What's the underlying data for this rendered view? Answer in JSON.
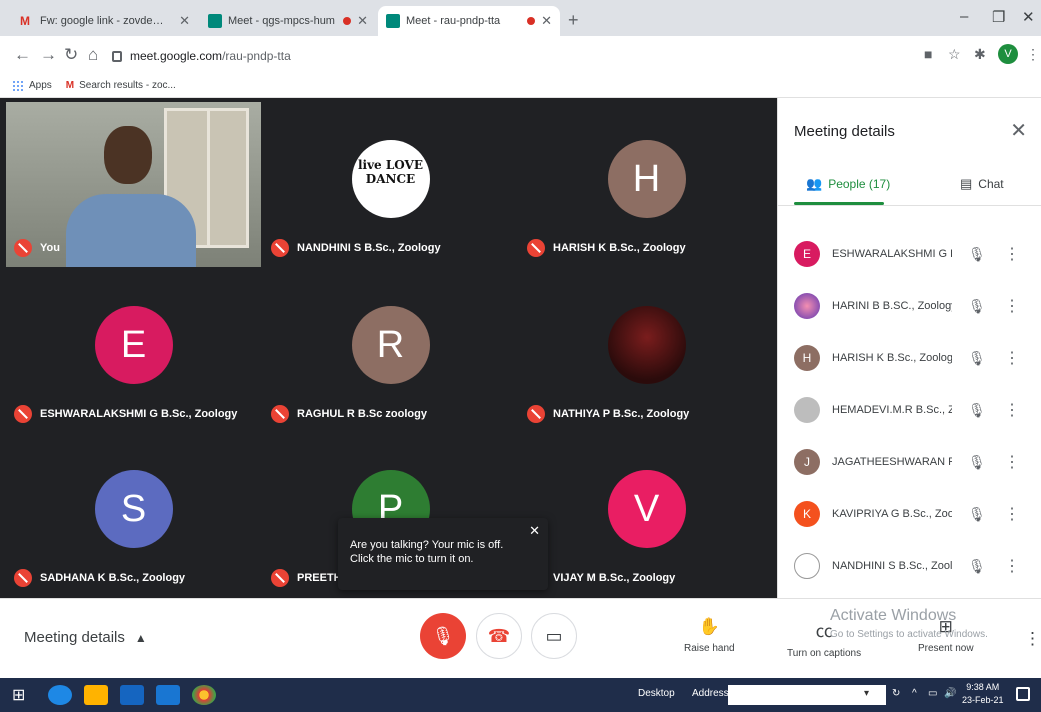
{
  "browser": {
    "tabs": [
      {
        "label": "Fw: google link - zovde@muthayammal",
        "active": false,
        "recording": false
      },
      {
        "label": "Meet - qgs-mpcs-hum",
        "active": false,
        "recording": true
      },
      {
        "label": "Meet - rau-pndp-tta",
        "active": true,
        "recording": true
      }
    ],
    "new_tab": "+",
    "window_controls": [
      "–",
      "❐",
      "✕"
    ],
    "url_host": "meet.google.com",
    "url_path": "/rau-pndp-tta",
    "profile_initial": "V",
    "bookmarks": [
      {
        "label": "Apps"
      },
      {
        "label": "Search results - zoc..."
      }
    ]
  },
  "meet": {
    "tiles": [
      {
        "label": "You",
        "type": "self"
      },
      {
        "label": "NANDHINI S B.Sc., Zoology",
        "type": "dance",
        "avatar_text": "live LOVE DANCE"
      },
      {
        "label": "HARISH K B.Sc., Zoology",
        "type": "letter",
        "letter": "H",
        "color": "#8d6e63"
      },
      {
        "label": "ESHWARALAKSHMI G B.Sc., Zoology",
        "type": "letter",
        "letter": "E",
        "color": "#d81b60"
      },
      {
        "label": "RAGHUL R B.Sc zoology",
        "type": "letter",
        "letter": "R",
        "color": "#8d6e63"
      },
      {
        "label": "NATHIYA P B.Sc., Zoology",
        "type": "dark"
      },
      {
        "label": "SADHANA K B.Sc., Zoology",
        "type": "letter",
        "letter": "S",
        "color": "#5c6bc0"
      },
      {
        "label": "PREETH",
        "type": "letter",
        "letter": "P",
        "color": "#2e7d32"
      },
      {
        "label": "VIJAY M B.Sc., Zoology",
        "type": "letter",
        "letter": "V",
        "color": "#e91e63"
      }
    ],
    "toast": {
      "message": "Are you talking? Your mic is off. Click the mic to turn it on.",
      "close": "✕"
    }
  },
  "panel": {
    "title": "Meeting details",
    "close": "✕",
    "tabs": {
      "people": "People (17)",
      "chat": "Chat"
    },
    "participants": [
      {
        "name": "ESHWARALAKSHMI G B...",
        "initial": "E",
        "color": "#d81b60"
      },
      {
        "name": "HARINI B B.SC., Zoology",
        "initial": "",
        "color": "#7e57c2"
      },
      {
        "name": "HARISH K B.Sc., Zoology",
        "initial": "H",
        "color": "#8d6e63"
      },
      {
        "name": "HEMADEVI.M.R B.Sc., Z...",
        "initial": "",
        "color": "#9e9e9e"
      },
      {
        "name": "JAGATHEESHWARAN R...",
        "initial": "J",
        "color": "#8d6e63"
      },
      {
        "name": "KAVIPRIYA G B.Sc., Zool...",
        "initial": "K",
        "color": "#f4511e"
      },
      {
        "name": "NANDHINI S B.Sc., Zool...",
        "initial": "",
        "color": "#ffffff"
      }
    ]
  },
  "bottom": {
    "meeting_details": "Meeting details",
    "raise_hand": "Raise hand",
    "captions": "Turn on captions",
    "present": "Present now",
    "watermark_title": "Activate Windows",
    "watermark_sub": "Go to Settings to activate Windows."
  },
  "taskbar": {
    "desktop": "Desktop",
    "address": "Address",
    "time": "9:38 AM",
    "date": "23-Feb-21"
  }
}
